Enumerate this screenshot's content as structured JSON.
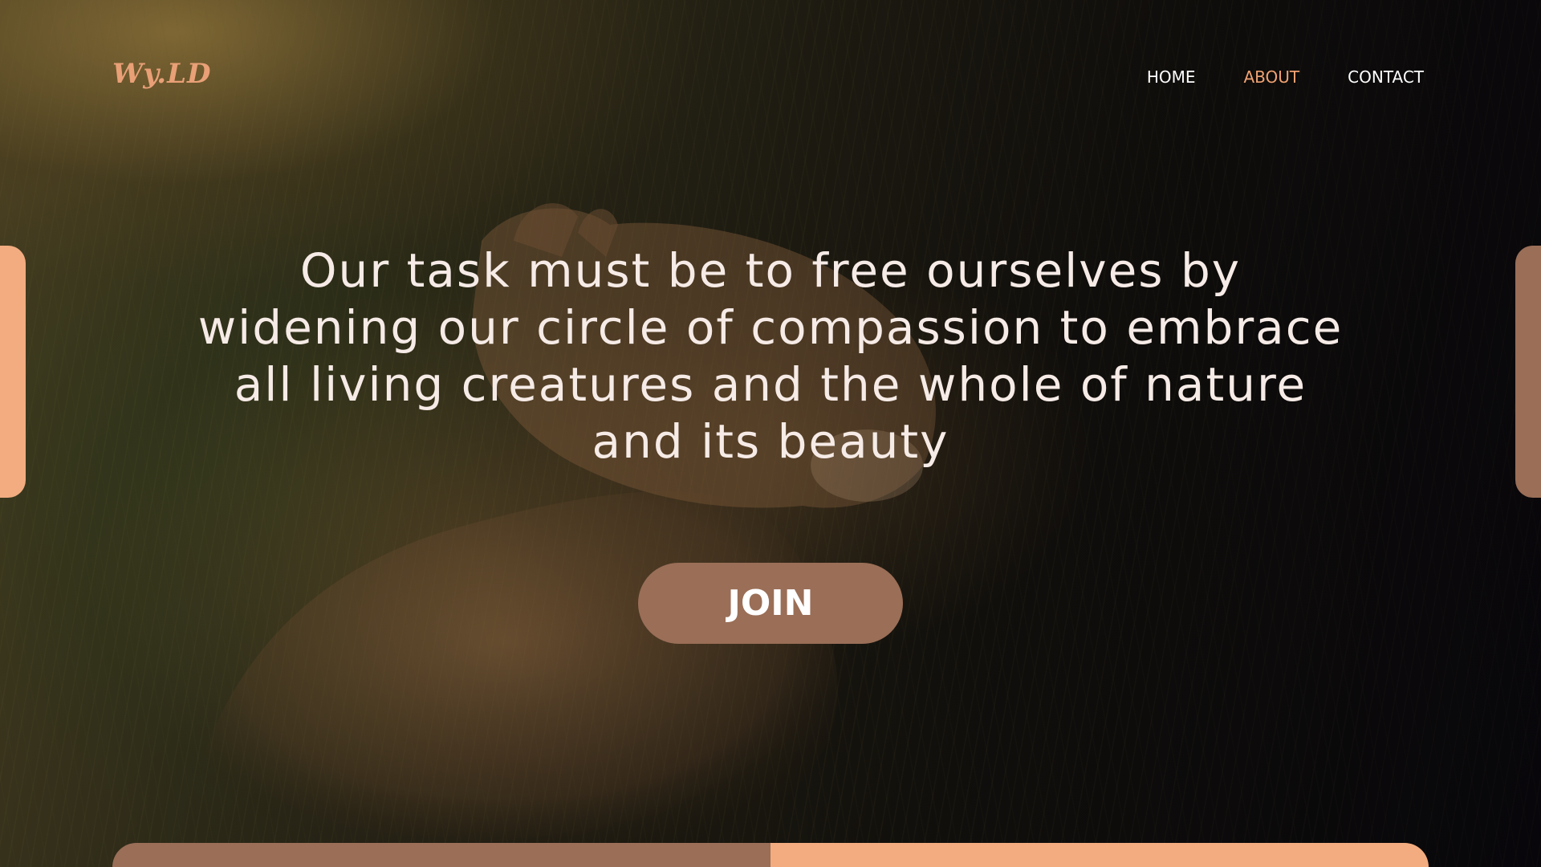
{
  "brand": {
    "logo_text": "Wy.LD",
    "logo_color": "#e9a077"
  },
  "nav": {
    "items": [
      {
        "label": "HOME",
        "active": false
      },
      {
        "label": "ABOUT",
        "active": true
      },
      {
        "label": "CONTACT",
        "active": false
      }
    ],
    "active_color": "#f0a273"
  },
  "hero": {
    "quote": "Our task must be to free ourselves by widening our circle of compassion to embrace all living creatures and the whole of nature and its beauty",
    "cta_label": "JOIN"
  },
  "colors": {
    "accent_brown": "#9a6e57",
    "accent_peach": "#f2ac80",
    "quote_text": "#f6ebe6"
  },
  "background": {
    "subject": "lion-in-grass-photo"
  }
}
